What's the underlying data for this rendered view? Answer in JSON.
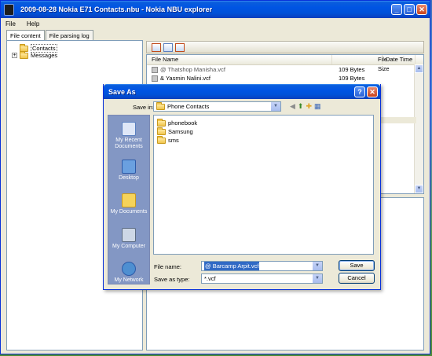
{
  "main": {
    "title": "2009-08-28 Nokia E71 Contacts.nbu - Nokia NBU explorer",
    "menu": [
      "File",
      "Help"
    ],
    "tabs": [
      "File content",
      "File parsing log"
    ],
    "tree": [
      {
        "label": "Contacts",
        "expanded": false,
        "selected": true
      },
      {
        "label": "Messages",
        "expanded": false,
        "selected": false
      }
    ],
    "list_columns": [
      "File Name",
      "File Size",
      "Date Time"
    ],
    "list_rows": [
      {
        "name": "@ Thatshop Manisha.vcf",
        "size": "109 Bytes"
      },
      {
        "name": "& Yasmin Nalini.vcf",
        "size": "109 Bytes"
      }
    ]
  },
  "dialog": {
    "title": "Save As",
    "save_in_label": "Save in:",
    "save_in_value": "Phone Contacts",
    "places": [
      "My Recent Documents",
      "Desktop",
      "My Documents",
      "My Computer",
      "My Network"
    ],
    "folders": [
      "phonebook",
      "Samsung",
      "sms"
    ],
    "file_name_label": "File name:",
    "file_name_value": "@ Barcamp Arpit.vcf",
    "save_type_label": "Save as type:",
    "save_type_value": "*.vcf",
    "save_button": "Save",
    "cancel_button": "Cancel",
    "help_glyph": "?",
    "close_glyph": "✕"
  },
  "window_controls": {
    "minimize": "_",
    "maximize": "□",
    "close": "✕"
  },
  "colors": {
    "titlebar": "#0054e3",
    "places_bar": "#8397c4",
    "selection": "#316ac5"
  }
}
